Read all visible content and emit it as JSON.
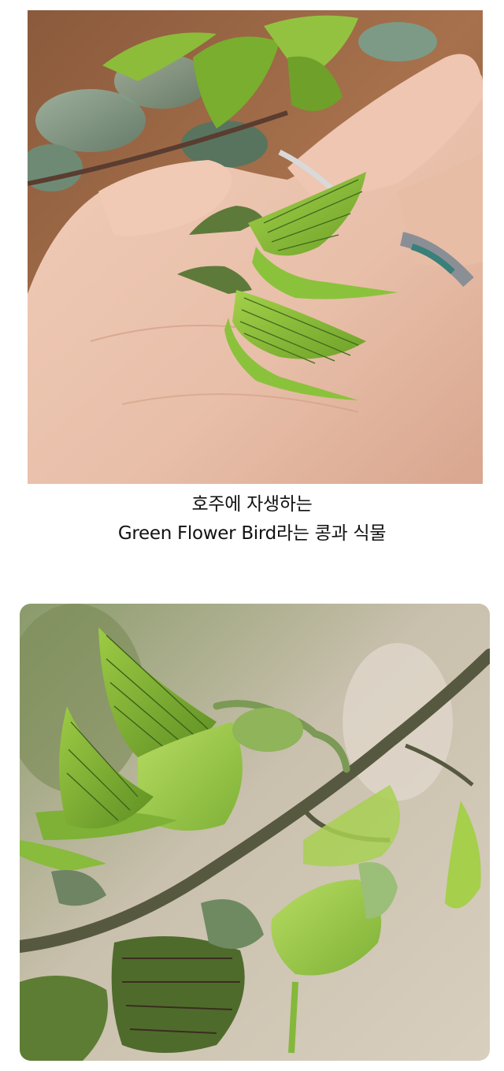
{
  "caption": {
    "line1": "호주에 자생하는",
    "line2": "Green Flower Bird라는 콩과 식물"
  },
  "colors": {
    "background": "#ffffff",
    "caption_text": "#111111",
    "flower_green": "#8fc23c",
    "skin": "#e9c2ad",
    "stem": "#56593f"
  }
}
